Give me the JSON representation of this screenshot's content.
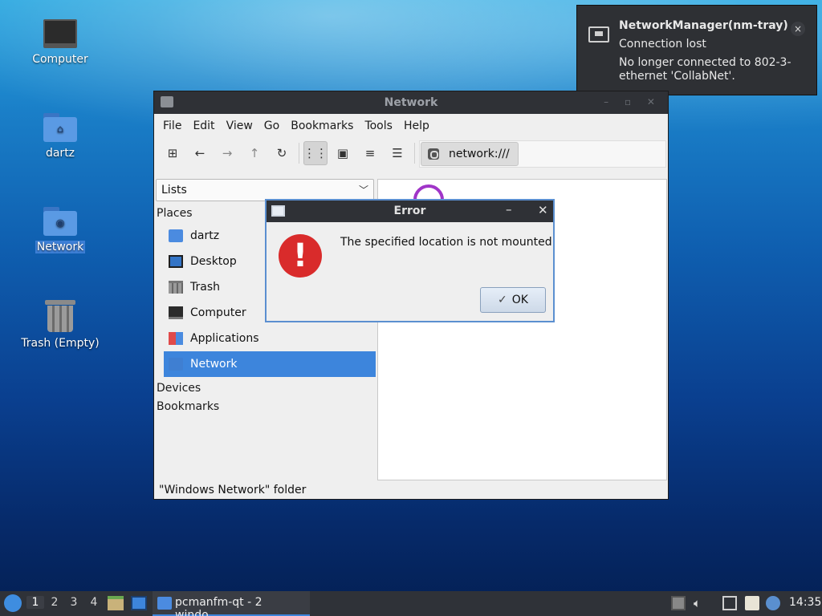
{
  "desktop": {
    "icons": [
      {
        "label": "Computer"
      },
      {
        "label": "dartz"
      },
      {
        "label": "Network"
      },
      {
        "label": "Trash (Empty)"
      }
    ]
  },
  "notification": {
    "title": "NetworkManager(nm-tray)",
    "subtitle": "Connection lost",
    "body": "No longer connected to 802-3-ethernet 'CollabNet'.",
    "close": "×"
  },
  "window": {
    "title": "Network",
    "menu": [
      "File",
      "Edit",
      "View",
      "Go",
      "Bookmarks",
      "Tools",
      "Help"
    ],
    "address": "network:///",
    "side_mode": "Lists",
    "places_header": "Places",
    "places": [
      {
        "label": "dartz",
        "icon": "home-folder-icon"
      },
      {
        "label": "Desktop",
        "icon": "desktop-icon"
      },
      {
        "label": "Trash",
        "icon": "trash-icon"
      },
      {
        "label": "Computer",
        "icon": "computer-icon"
      },
      {
        "label": "Applications",
        "icon": "applications-icon"
      },
      {
        "label": "Network",
        "icon": "network-icon"
      }
    ],
    "devices_header": "Devices",
    "bookmarks_header": "Bookmarks",
    "status": "\"Windows Network\" folder"
  },
  "dialog": {
    "title": "Error",
    "minimize": "–",
    "close": "✕",
    "message": "The specified location is not mounted",
    "ok_label": "OK"
  },
  "taskbar": {
    "workspaces": [
      "1",
      "2",
      "3",
      "4"
    ],
    "task_label": "pcmanfm-qt - 2 windo…",
    "clock": "14:35"
  },
  "colors": {
    "accent": "#3d85dc",
    "error": "#d92b2b",
    "titlebar": "#2f3136"
  }
}
